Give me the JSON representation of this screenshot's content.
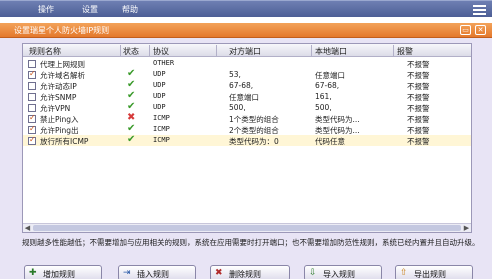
{
  "menubar": {
    "items": [
      "操作",
      "设置",
      "帮助"
    ]
  },
  "dialog": {
    "title": "设置瑞星个人防火墙IP规则"
  },
  "grid": {
    "headers": [
      "规则名称",
      "状态",
      "协议",
      "对方端口",
      "本地端口",
      "报警"
    ],
    "rows": [
      {
        "checked": false,
        "name": "代理上网规则",
        "status": "",
        "protocol": "OTHER",
        "remote": "",
        "local": "",
        "alarm": "不报警"
      },
      {
        "checked": true,
        "name": "允许域名解析",
        "status": "allow",
        "protocol": "UDP",
        "remote": "53,",
        "local": "任意端口",
        "alarm": "不报警"
      },
      {
        "checked": false,
        "name": "允许动态IP",
        "status": "allow",
        "protocol": "UDP",
        "remote": "67-68,",
        "local": "67-68,",
        "alarm": "不报警"
      },
      {
        "checked": false,
        "name": "允许SNMP",
        "status": "allow",
        "protocol": "UDP",
        "remote": "任意端口",
        "local": "161,",
        "alarm": "不报警"
      },
      {
        "checked": false,
        "name": "允许VPN",
        "status": "allow",
        "protocol": "UDP",
        "remote": "500,",
        "local": "500,",
        "alarm": "不报警"
      },
      {
        "checked": true,
        "name": "禁止Ping入",
        "status": "deny",
        "protocol": "ICMP",
        "remote": "1个类型的组合",
        "local": "类型代码为...",
        "alarm": "不报警"
      },
      {
        "checked": true,
        "name": "允许Ping出",
        "status": "allow",
        "protocol": "ICMP",
        "remote": "2个类型的组合",
        "local": "类型代码为...",
        "alarm": "不报警"
      },
      {
        "checked": true,
        "name": "放行所有ICMP",
        "status": "allow",
        "protocol": "ICMP",
        "remote": "类型代码为：0",
        "local": "代码任意",
        "alarm": "不报警"
      }
    ]
  },
  "note": "规则越多性能越低；不需要增加与应用相关的规则，系统在应用需要时打开端口；也不需要增加防范性规则，系统已经内置并且自动升级。",
  "buttons": [
    "增加规则",
    "插入规则",
    "删除规则",
    "导入规则",
    "导出规则"
  ],
  "icons": {
    "status_allow": "check-icon",
    "status_deny": "cross-icon",
    "menu": "menu-icon"
  },
  "colors": {
    "menubar": "#5a6aa0",
    "titlebar": "#ec8a3e",
    "dialog_bg": "#e8e4f5",
    "allow": "#3a9a2a",
    "deny": "#d63a3a"
  }
}
